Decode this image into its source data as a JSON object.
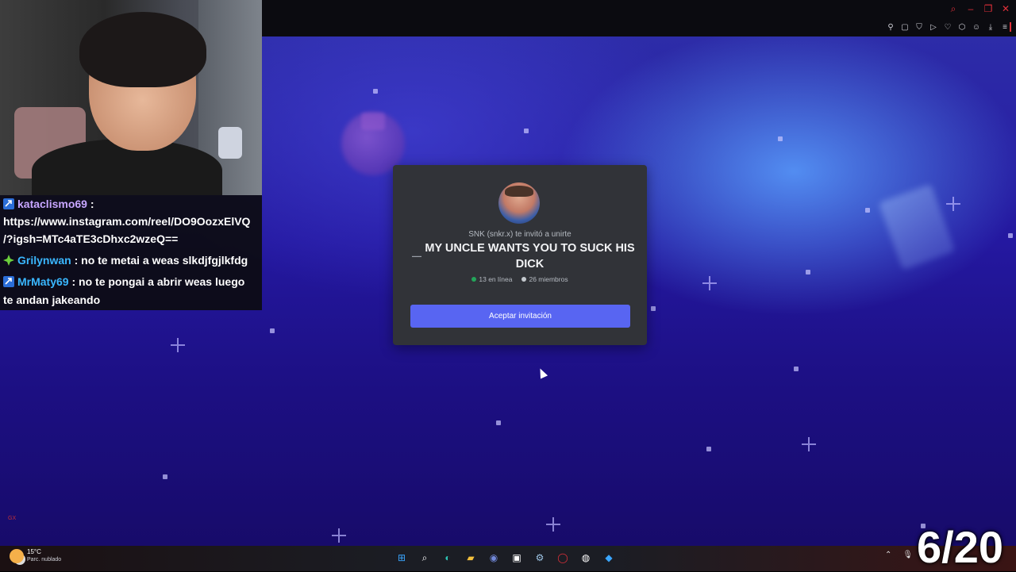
{
  "invite": {
    "inviter_text": "SNK (snkr.x) te invitó a unirte",
    "server_name": "MY UNCLE WANTS YOU TO SUCK HIS DICK",
    "online_text": "13 en línea",
    "members_text": "26 miembros",
    "accept_label": "Aceptar invitación",
    "online_color": "#23a55a",
    "members_color": "#b5bac1",
    "button_color": "#5865f2"
  },
  "chat": {
    "messages": [
      {
        "user": "kataclismo69",
        "user_color": "#c7a6ff",
        "separator": " :",
        "text_line1": "https://www.instagram.com/reel/DO9OozxElVQ",
        "text_line2": "/?igsh=MTc4aTE3cDhxc2wzeQ=="
      },
      {
        "user": "Grilynwan",
        "user_color": "#3ab7ff",
        "separator": " : ",
        "text": "no te metai a weas slkdjfgjlkfdg"
      },
      {
        "user": "MrMaty69",
        "user_color": "#3ab7ff",
        "separator": " : ",
        "text_line1": "no te pongai a abrir weas luego",
        "text_line2": "te andan jakeando"
      }
    ]
  },
  "overlay": {
    "counter": "6/20"
  },
  "taskbar": {
    "weather_temp": "15°C",
    "weather_desc": "Parc. nublado",
    "icons": [
      "windows-start-icon",
      "search-icon",
      "edge-icon",
      "file-explorer-icon",
      "discord-icon",
      "terminal-icon",
      "steam-icon",
      "opera-gx-icon",
      "obs-icon",
      "vscode-icon"
    ]
  },
  "browser": {
    "window_controls": [
      "search-icon",
      "minimize-icon",
      "restore-icon",
      "close-icon"
    ],
    "toolbar_icons": [
      "pin-icon",
      "snapshot-icon",
      "shield-icon",
      "play-icon",
      "heart-icon",
      "extensions-icon",
      "profile-icon",
      "download-icon",
      "menu-icon"
    ]
  },
  "sidebar": {
    "gx_label": "GX"
  }
}
